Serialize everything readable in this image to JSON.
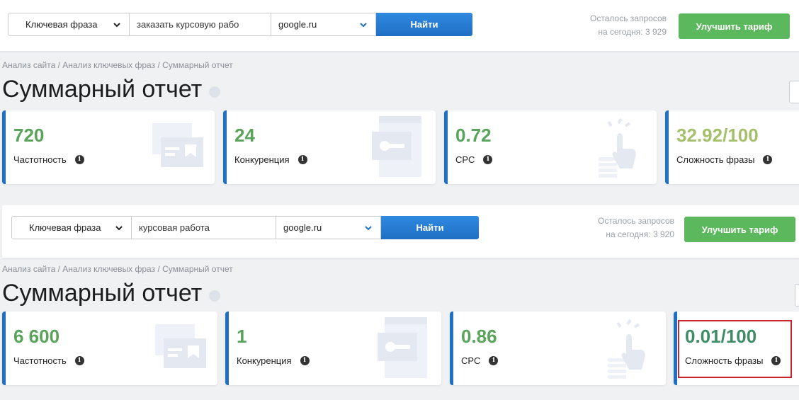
{
  "panels": [
    {
      "search": {
        "type_select": "Ключевая фраза",
        "keyword_value": "заказать курсовую рабо",
        "engine_select": "google.ru",
        "find_label": "Найти"
      },
      "limit": {
        "line1": "Осталось запросов",
        "line2": "на сегодня: 3 929"
      },
      "upgrade_label": "Улучшить тариф",
      "breadcrumb": [
        "Анализ сайта",
        "Анализ ключевых фраз",
        "Суммарный отчет"
      ],
      "breadcrumb_sep": " / ",
      "title": "Суммарный отчет",
      "cards": [
        {
          "value": "720",
          "label": "Частотность",
          "icon": "ads-icon"
        },
        {
          "value": "24",
          "label": "Конкуренция",
          "icon": "key-window-icon"
        },
        {
          "value": "0.72",
          "label": "CPC",
          "icon": "hand-click-icon"
        },
        {
          "value": "32.92/100",
          "label": "Сложность фразы",
          "icon": ""
        }
      ]
    },
    {
      "search": {
        "type_select": "Ключевая фраза",
        "keyword_value": "курсовая работа",
        "engine_select": "google.ru",
        "find_label": "Найти"
      },
      "limit": {
        "line1": "Осталось запросов",
        "line2": "на сегодня: 3 920"
      },
      "upgrade_label": "Улучшить тариф",
      "breadcrumb": [
        "Анализ сайта",
        "Анализ ключевых фраз",
        "Суммарный отчет"
      ],
      "breadcrumb_sep": " / ",
      "title": "Суммарный отчет",
      "cards": [
        {
          "value": "6 600",
          "label": "Частотность",
          "icon": "ads-icon"
        },
        {
          "value": "1",
          "label": "Конкуренция",
          "icon": "key-window-icon"
        },
        {
          "value": "0.86",
          "label": "CPC",
          "icon": "hand-click-icon"
        },
        {
          "value": "0.01/100",
          "label": "Сложность фразы",
          "icon": ""
        }
      ]
    }
  ],
  "info_glyph": "i",
  "colors": {
    "accent_blue": "#1f6fc4",
    "value_green": "#5aa35a",
    "upgrade_green": "#5cb85c",
    "difficulty_olive": "#a4c06a",
    "highlight_red": "#c9252b"
  }
}
